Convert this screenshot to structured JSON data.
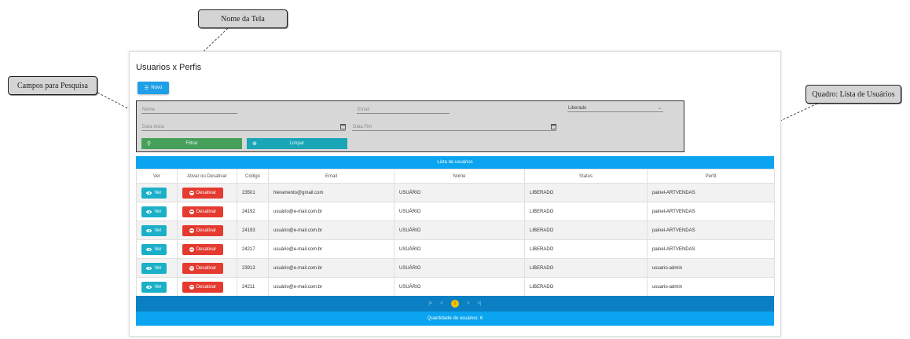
{
  "callouts": {
    "nome_tela": "Nome da Tela",
    "campos_pesquisa": "Campos para Pesquisa",
    "quadro_lista": "Quadro: Lista de Usuários"
  },
  "page": {
    "title": "Usuarios x Perfis"
  },
  "toolbar": {
    "novo_label": "Novo"
  },
  "filters": {
    "nome_placeholder": "Nome",
    "email_placeholder": "Email",
    "liberado_value": "Liberado",
    "data_inicio_placeholder": "Data Inicio",
    "data_fim_placeholder": "Data Fim",
    "filtrar_label": "Filtrar",
    "limpar_label": "Limpar"
  },
  "list": {
    "title": "Lista de usuários",
    "columns": [
      "Ver",
      "Ativar ou Desativar",
      "Código",
      "Email",
      "Nome",
      "Status",
      "Perfil"
    ],
    "ver_label": "Ver",
    "desativar_label": "Desativar",
    "rows": [
      {
        "codigo": "23501",
        "email": "hieramento@gmail.com",
        "nome": "USUÁRIO",
        "status": "LIBERADO",
        "perfil": "painel-ARTVENDAS"
      },
      {
        "codigo": "24192",
        "email": "usuário@e-mail.com.br",
        "nome": "USUÁRIO",
        "status": "LIBERADO",
        "perfil": "painel-ARTVENDAS"
      },
      {
        "codigo": "24193",
        "email": "usuário@e-mail.com.br",
        "nome": "USUÁRIO",
        "status": "LIBERADO",
        "perfil": "painel-ARTVENDAS"
      },
      {
        "codigo": "24217",
        "email": "usuário@e-mail.com.br",
        "nome": "USUÁRIO",
        "status": "LIBERADO",
        "perfil": "painel-ARTVENDAS"
      },
      {
        "codigo": "23913",
        "email": "usuário@e-mail.com.br",
        "nome": "USUÁRIO",
        "status": "LIBERADO",
        "perfil": "usuario-admin"
      },
      {
        "codigo": "24211",
        "email": "usuário@e-mail.com.br",
        "nome": "USUÁRIO",
        "status": "LIBERADO",
        "perfil": "usuario-admin"
      }
    ]
  },
  "pager": {
    "current_page": "1"
  },
  "footer": {
    "count_text": "Quantidade de usuários: 6"
  },
  "colors": {
    "primary": "#0aa4f0",
    "pager": "#0b7fc3",
    "ver": "#1ab0c8",
    "desativar": "#e53a2f",
    "filtrar": "#46a05a"
  }
}
